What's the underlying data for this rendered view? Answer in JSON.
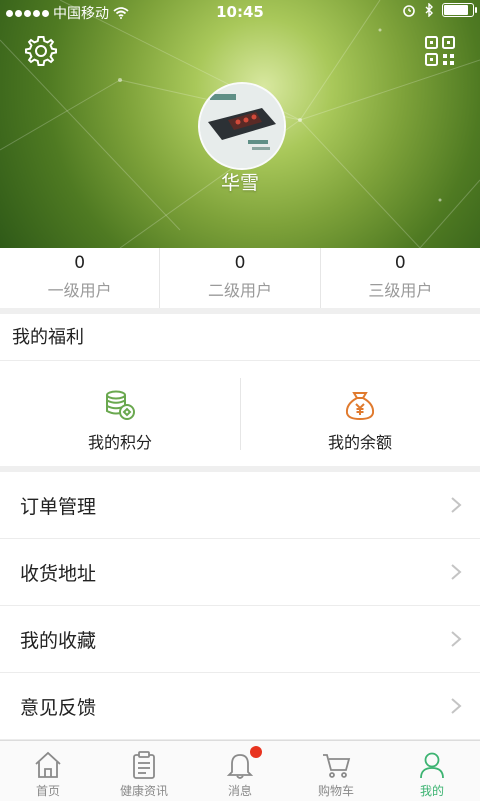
{
  "status_bar": {
    "carrier": "中国移动",
    "time": "10:45"
  },
  "header": {
    "username": "华雪",
    "icons": [
      "gear-icon",
      "qr-code-icon"
    ]
  },
  "stats": [
    {
      "count": "0",
      "label": "一级用户"
    },
    {
      "count": "0",
      "label": "二级用户"
    },
    {
      "count": "0",
      "label": "三级用户"
    }
  ],
  "benefits": {
    "title": "我的福利",
    "items": [
      {
        "label": "我的积分",
        "icon": "coins-icon",
        "color": "#6aa84f"
      },
      {
        "label": "我的余额",
        "icon": "money-bag-icon",
        "color": "#e07a2e"
      }
    ]
  },
  "menu": [
    {
      "label": "订单管理"
    },
    {
      "label": "收货地址"
    },
    {
      "label": "我的收藏"
    },
    {
      "label": "意见反馈"
    }
  ],
  "tabbar": {
    "tabs": [
      {
        "label": "首页",
        "icon": "home-icon"
      },
      {
        "label": "健康资讯",
        "icon": "clipboard-icon"
      },
      {
        "label": "消息",
        "icon": "bell-icon"
      },
      {
        "label": "购物车",
        "icon": "cart-icon"
      },
      {
        "label": "我的",
        "icon": "user-icon"
      }
    ],
    "active_color": "#3cb371",
    "badge_color": "#e8331f"
  }
}
